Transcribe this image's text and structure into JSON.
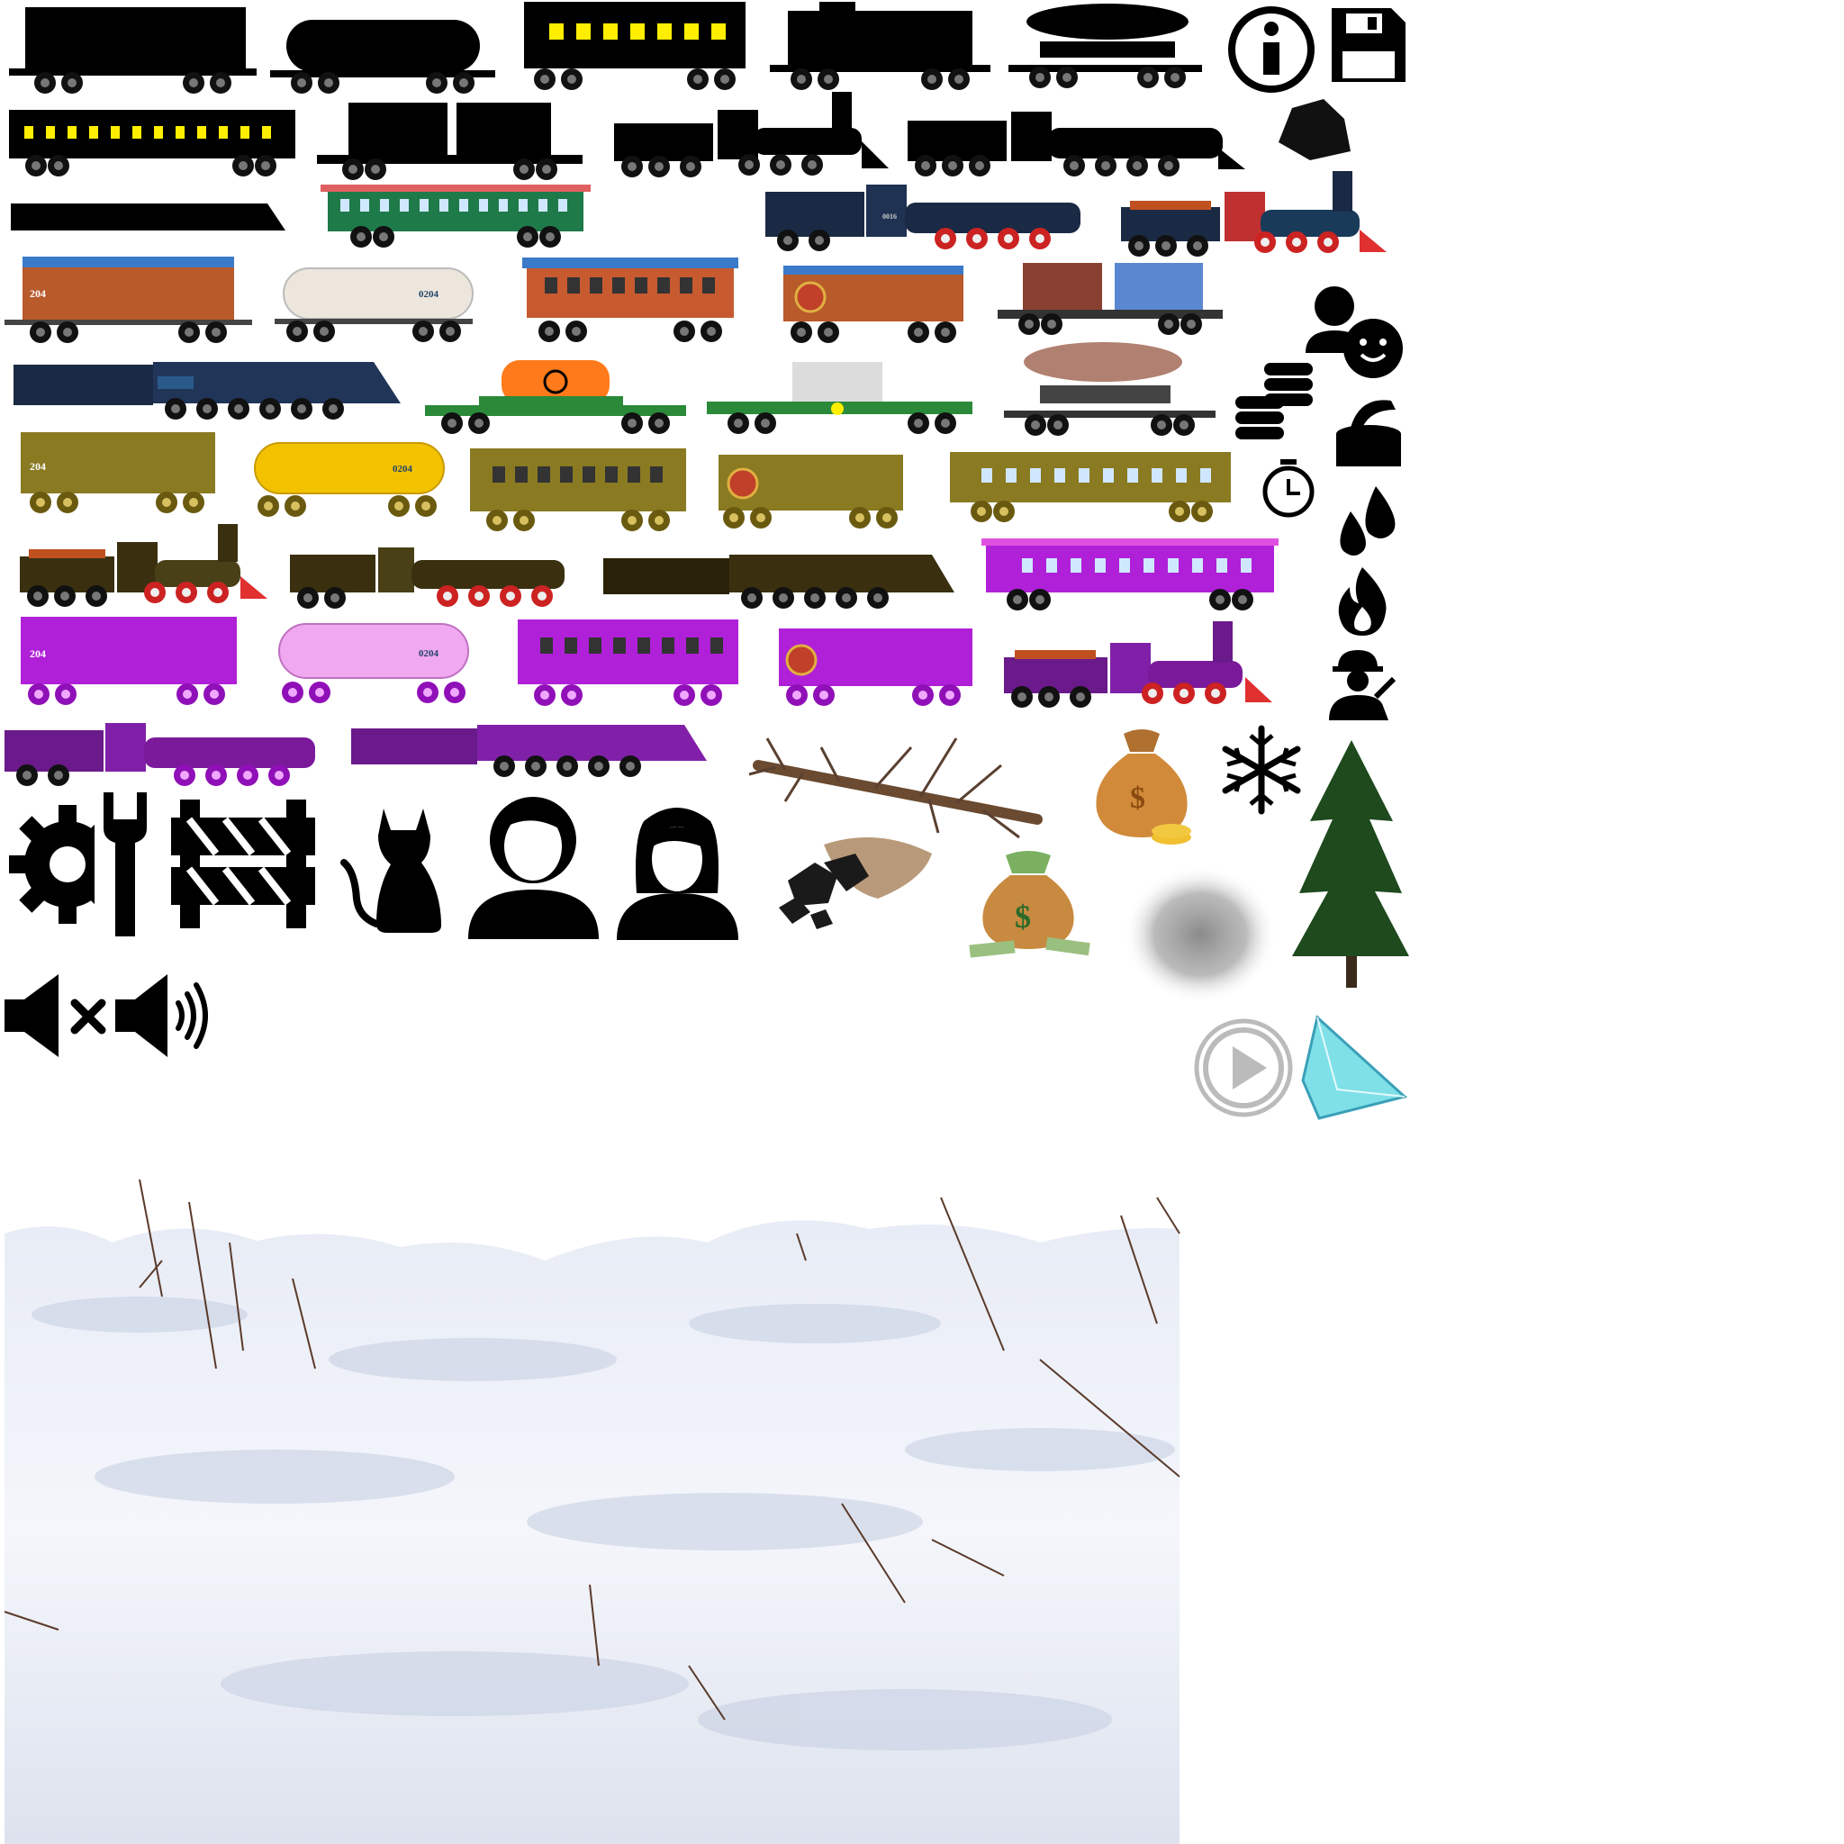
{
  "atlas": {
    "colors": {
      "silhouette": "#000000",
      "window_yellow": "#ffee00",
      "brown_body": "#b85a2a",
      "blue_roof": "#3a7ac8",
      "green_body": "#1f7a4a",
      "red_wheel": "#cc2222",
      "navy_body": "#1a2a44",
      "olive_body": "#8a7a22",
      "gold_tank": "#f2c200",
      "purple_body": "#b020d8",
      "pink_tank": "#f0a8f0",
      "cream_tank": "#ece6dc",
      "orange_tank": "#ff7a1a",
      "snow": "#f2f4fa",
      "tree_green": "#1e4a1e",
      "crystal": "#7fe0e8",
      "smoke": "#8a8a8a",
      "money_bag": "#d08a3a",
      "play_grey": "#bbbbbb"
    },
    "car_labels": {
      "boxcar_number": "204",
      "tank_number": "0204",
      "loco_number": "0016"
    },
    "icons": [
      "info-icon",
      "save-icon",
      "coal-lump-icon",
      "user-smile-icon",
      "coins-icon",
      "stopwatch-icon",
      "open-can-icon",
      "water-drops-icon",
      "fire-icon",
      "engineer-icon",
      "snowflake-icon",
      "settings-wrench-icon",
      "road-barrier-icon",
      "cat-icon",
      "male-avatar-icon",
      "female-avatar-icon",
      "sound-muted-icon",
      "sound-on-icon",
      "play-icon"
    ]
  }
}
